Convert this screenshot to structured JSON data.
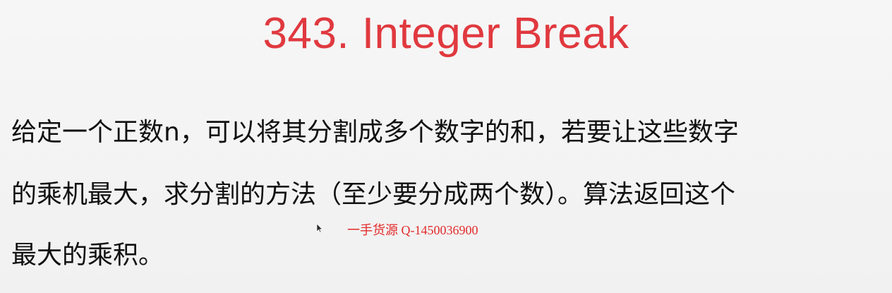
{
  "slide": {
    "title": "343. Integer Break",
    "lines": [
      "给定一个正数n，可以将其分割成多个数字的和，若要让这些数字",
      "的乘机最大，求分割的方法（至少要分成两个数）。算法返回这个",
      "最大的乘积。"
    ]
  },
  "overlay": {
    "watermark": "一手货源 Q-1450036900",
    "cursor_icon": "mouse-pointer-icon"
  },
  "colors": {
    "title": "#e0393f",
    "text": "#111111",
    "watermark": "#e32a2a",
    "background": "#f3f3f3"
  }
}
